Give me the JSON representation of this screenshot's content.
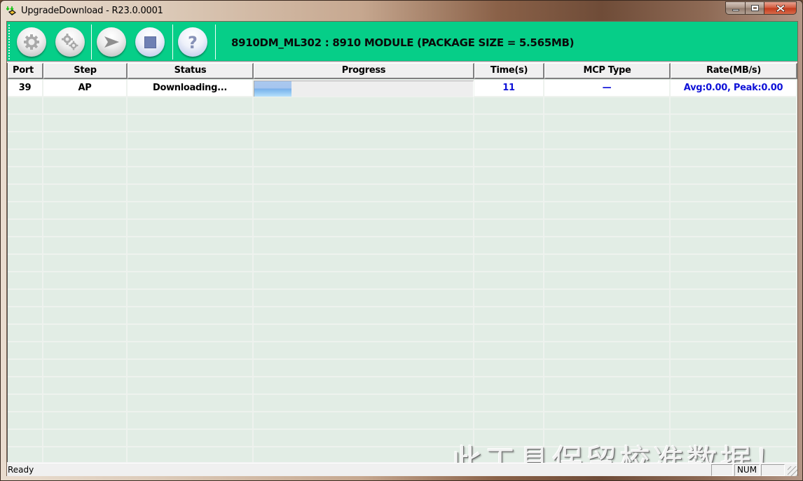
{
  "window": {
    "title": "UpgradeDownload - R23.0.0001",
    "icon": "upgrade-download-app-icon",
    "caption_buttons": [
      "minimize",
      "maximize",
      "close"
    ]
  },
  "toolbar": {
    "background_color": "#06ce88",
    "buttons": [
      {
        "name": "settings",
        "icon": "gear-icon"
      },
      {
        "name": "advanced-settings",
        "icon": "gears-icon"
      },
      {
        "name": "start",
        "icon": "play-arrow-icon"
      },
      {
        "name": "stop",
        "icon": "stop-square-icon"
      },
      {
        "name": "help",
        "icon": "question-mark-icon"
      }
    ],
    "package_title": "8910DM_ML302 : 8910 MODULE (PACKAGE SIZE = 5.565MB)"
  },
  "grid": {
    "columns": [
      "Port",
      "Step",
      "Status",
      "Progress",
      "Time(s)",
      "MCP Type",
      "Rate(MB/s)"
    ],
    "rows": [
      {
        "port": "39",
        "step": "AP",
        "status": "Downloading...",
        "progress_percent": 17,
        "time": "11",
        "mcp_type": "—",
        "rate": "Avg:0.00, Peak:0.00"
      }
    ],
    "value_color": "#0f12d8"
  },
  "watermark": "此工具保留校准数据！",
  "statusbar": {
    "text": "Ready",
    "panes": [
      "",
      "NUM",
      ""
    ]
  }
}
